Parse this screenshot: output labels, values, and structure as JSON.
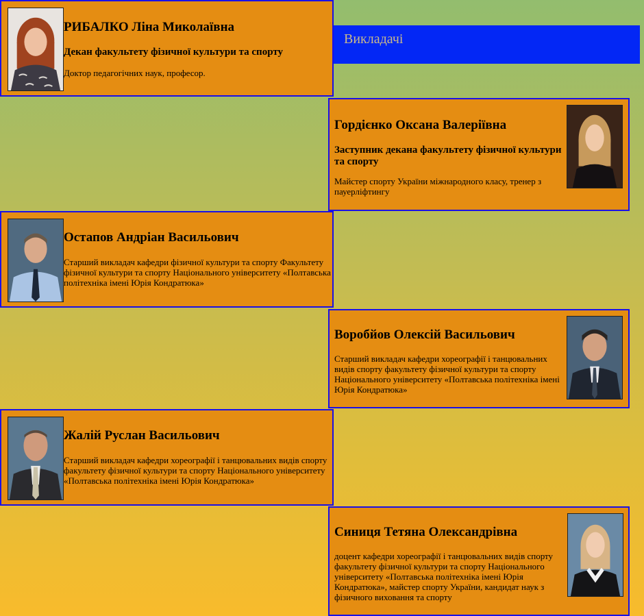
{
  "header": {
    "title": "Викладачі"
  },
  "staff": [
    {
      "name": "РИБАЛКО Ліна Миколаївна",
      "position": "Декан факультету фізичної культури та спорту",
      "description": "Доктор педагогічних наук, професор."
    },
    {
      "name": "Гордієнко Оксана Валеріївна",
      "position": "Заступник декана факультету фізичної культури та спорту",
      "description": "Майстер спорту України міжнародного класу, тренер з пауерліфтингу"
    },
    {
      "name": "Остапов Андріан Васильович",
      "description": "Старший викладач кафедри фізичної культури та спорту Факультету фізичної культури та спорту Національного університету «Полтавська політехніка імені Юрія Кондратюка»"
    },
    {
      "name": "Воробйов Олексій Васильович",
      "description": "Старший викладач кафедри хореографії і танцювальних видів спорту факультету фізичної культури та спорту Національного університету «Полтавська політехніка імені Юрія Кондратюка»"
    },
    {
      "name": "Жалій Руслан Васильович",
      "description": "Старший викладач кафедри хореографії і танцювальних видів спорту факультету фізичної культури та спорту Національного університету «Полтавська політехніка імені Юрія Кондратюка»"
    },
    {
      "name": "Синиця Тетяна Олександрівна",
      "description": "доцент кафедри хореографії і танцювальних видів спорту факультету фізичної культури та спорту Національного університету «Полтавська політехніка імені Юрія Кондратюка», майстер спорту України, кандидат наук з фізичного виховання та спорту"
    }
  ],
  "colors": {
    "card_background": "#e58d12",
    "card_border": "#1a10e6",
    "title_bar": "#0327f5",
    "title_text": "#c9b98a"
  }
}
